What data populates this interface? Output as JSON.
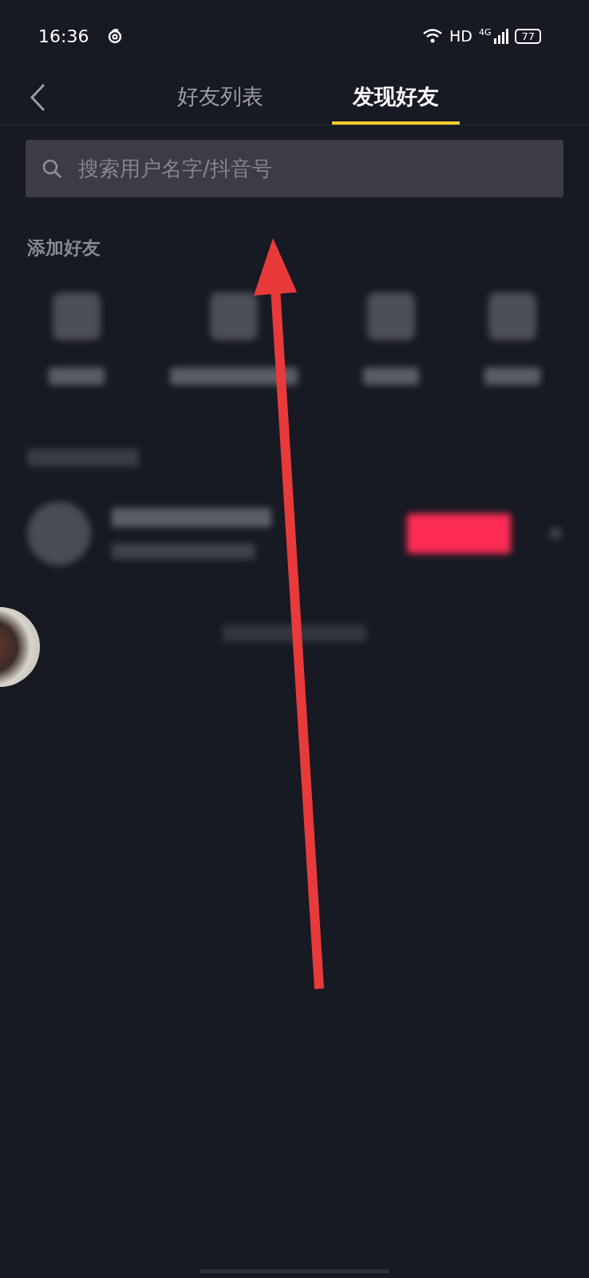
{
  "status_bar": {
    "time": "16:36",
    "hd": "HD",
    "network": "4G",
    "battery": "77"
  },
  "tabs": [
    {
      "label": "好友列表",
      "selected": false
    },
    {
      "label": "发现好友",
      "selected": true
    }
  ],
  "search": {
    "placeholder": "搜索用户名字/抖音号"
  },
  "section_title": "添加好友"
}
